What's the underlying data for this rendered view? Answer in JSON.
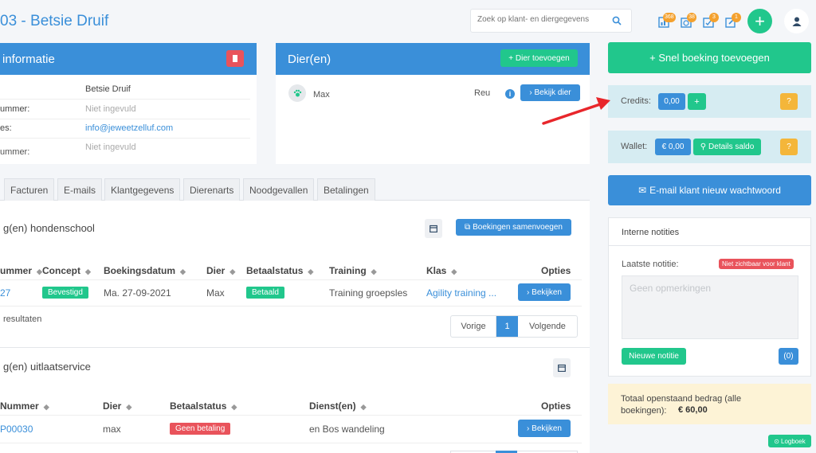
{
  "header": {
    "title": "03 - Betsie Druif",
    "search_placeholder": "Zoek op klant- en diergegevens",
    "badges": [
      "368",
      "38",
      "3",
      "1"
    ]
  },
  "client_info": {
    "title": "informatie",
    "rows": [
      {
        "label": "",
        "value": "Betsie Druif"
      },
      {
        "label": "ummer:",
        "value": "Niet ingevuld"
      },
      {
        "label": "es:",
        "value": "info@jeweetzelluf.com"
      },
      {
        "label": "",
        "value": "Niet ingevuld"
      }
    ]
  },
  "animals": {
    "title": "Dier(en)",
    "add_button": "+ Dier toevoegen",
    "name": "Max",
    "gender": "Reu",
    "view_button": "› Bekijk dier"
  },
  "tabs": [
    "Facturen",
    "E-mails",
    "Klantgegevens",
    "Dierenarts",
    "Noodgevallen",
    "Betalingen"
  ],
  "school": {
    "title": "g(en) hondenschool",
    "merge_button": "Boekingen samenvoegen",
    "headers": [
      "ummer",
      "Concept",
      "Boekingsdatum",
      "Dier",
      "Betaalstatus",
      "Training",
      "Klas",
      "Opties"
    ],
    "row": {
      "nummer": "27",
      "concept": "Bevestigd",
      "datum": "Ma. 27-09-2021",
      "dier": "Max",
      "status": "Betaald",
      "training": "Training groepsles",
      "klas": "Agility training ...",
      "action": "› Bekijken"
    },
    "results": "resultaten",
    "pagination": {
      "prev": "Vorige",
      "page": "1",
      "next": "Volgende"
    }
  },
  "walk": {
    "title": "g(en) uitlaatservice",
    "headers": [
      "Nummer",
      "Dier",
      "Betaalstatus",
      "Dienst(en)",
      "Opties"
    ],
    "row": {
      "nummer": "P00030",
      "dier": "max",
      "status": "Geen betaling",
      "dienst": "en Bos wandeling",
      "action": "› Bekijken"
    }
  },
  "sidebar": {
    "quick_booking": "+ Snel boeking toevoegen",
    "credits_label": "Credits:",
    "credits_value": "0,00",
    "credits_add": "+",
    "help": "?",
    "wallet_label": "Wallet:",
    "wallet_value": "€ 0,00",
    "wallet_details": "Details saldo",
    "email_reset": "E-mail klant nieuw wachtwoord",
    "notes_title": "Interne notities",
    "last_note_label": "Laatste notitie:",
    "not_visible_badge": "Niet zichtbaar voor klant",
    "notes_placeholder": "Geen opmerkingen",
    "new_note": "Nieuwe notitie",
    "note_count": "(0)",
    "total_text": "Totaal openstaand bedrag (alle boekingen):",
    "total_amount": "€ 60,00",
    "logbook": "Logboek"
  },
  "colors": {
    "blue": "#3a8fd9",
    "green": "#21c78c",
    "red": "#e9535b",
    "orange": "#f4b63a",
    "arrow": "#e8262b"
  }
}
